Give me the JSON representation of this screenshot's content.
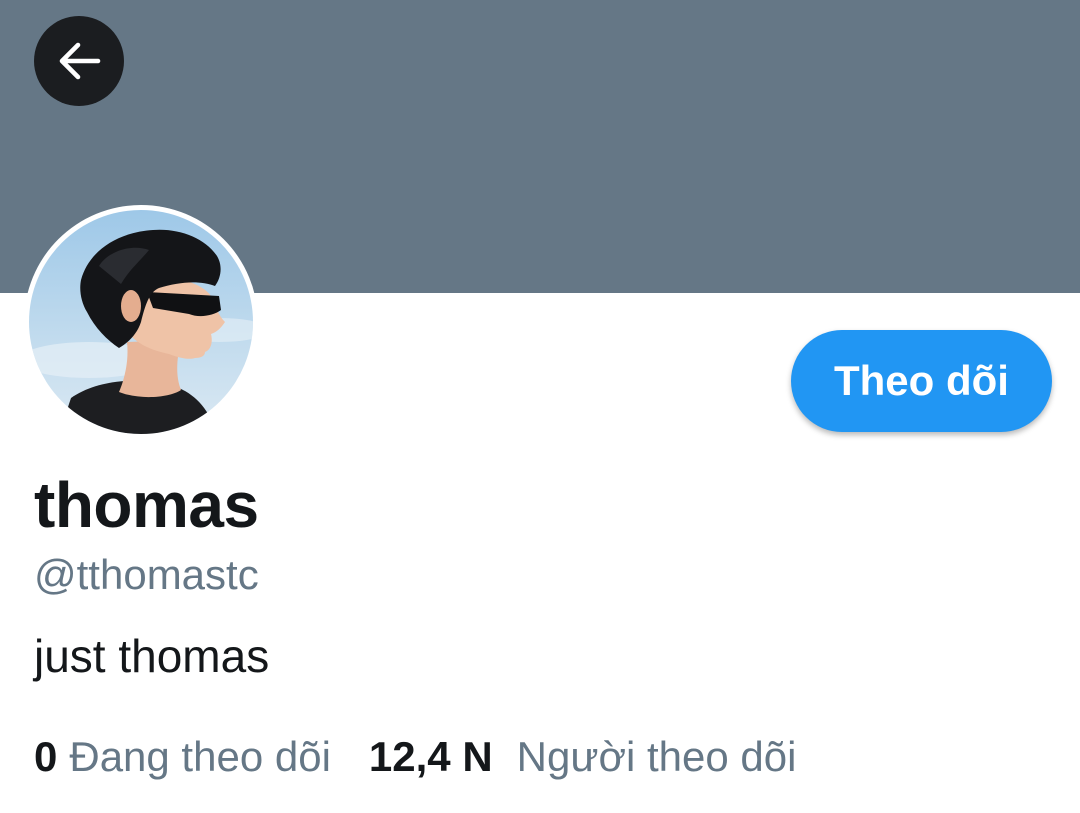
{
  "header": {
    "banner_color": "#657786",
    "back_icon": "arrow-left-icon"
  },
  "profile": {
    "display_name": "thomas",
    "handle": "@tthomastc",
    "bio": "just thomas",
    "avatar_description": "profile-photo"
  },
  "actions": {
    "follow_label": "Theo dõi",
    "follow_color": "#2196f3"
  },
  "stats": {
    "following_count": "0",
    "following_label": "Đang theo dõi",
    "followers_count": "12,4 N",
    "followers_label": "Người theo dõi"
  }
}
